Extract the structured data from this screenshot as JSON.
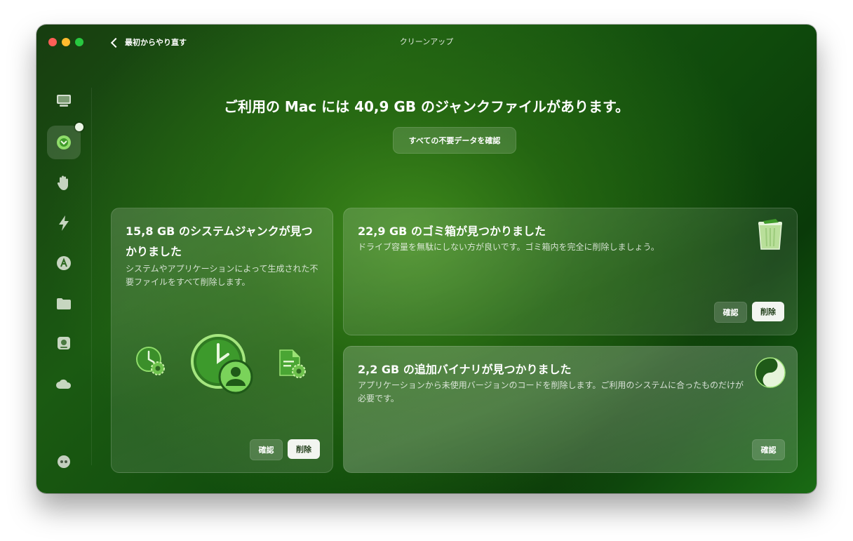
{
  "window": {
    "title": "クリーンアップ",
    "back_label": "最初からやり直す"
  },
  "sidebar": {
    "items": [
      {
        "name": "computer",
        "icon": "monitor-icon"
      },
      {
        "name": "cleanup",
        "icon": "cleanup-icon",
        "active": true
      },
      {
        "name": "protection",
        "icon": "hand-icon"
      },
      {
        "name": "performance",
        "icon": "bolt-icon"
      },
      {
        "name": "applications",
        "icon": "apps-icon"
      },
      {
        "name": "files",
        "icon": "folder-icon"
      },
      {
        "name": "space-lens",
        "icon": "disk-icon"
      },
      {
        "name": "cloud",
        "icon": "cloud-icon"
      }
    ],
    "bottom_icon": "assistant-icon"
  },
  "main": {
    "headline": "ご利用の Mac には 40,9 GB のジャンクファイルがあります。",
    "review_all_label": "すべての不要データを確認"
  },
  "cards": [
    {
      "title": "15,8 GB のシステムジャンクが見つかりました",
      "description": "システムやアプリケーションによって生成された不要ファイルをすべて削除します。",
      "review_label": "確認",
      "delete_label": "削除"
    },
    {
      "title": "22,9 GB のゴミ箱が見つかりました",
      "description": "ドライブ容量を無駄にしない方が良いです。ゴミ箱内を完全に削除しましょう。",
      "review_label": "確認",
      "delete_label": "削除",
      "icon": "trash-icon"
    },
    {
      "title": "2,2 GB の追加バイナリが見つかりました",
      "description": "アプリケーションから未使用バージョンのコードを削除します。ご利用のシステムに合ったものだけが必要です。",
      "review_label": "確認",
      "icon": "binaries-icon"
    }
  ],
  "colors": {
    "accent_dark": "#0f4a0c",
    "accent_light": "#3f8a1c",
    "icon_green": "#7dd36a"
  }
}
